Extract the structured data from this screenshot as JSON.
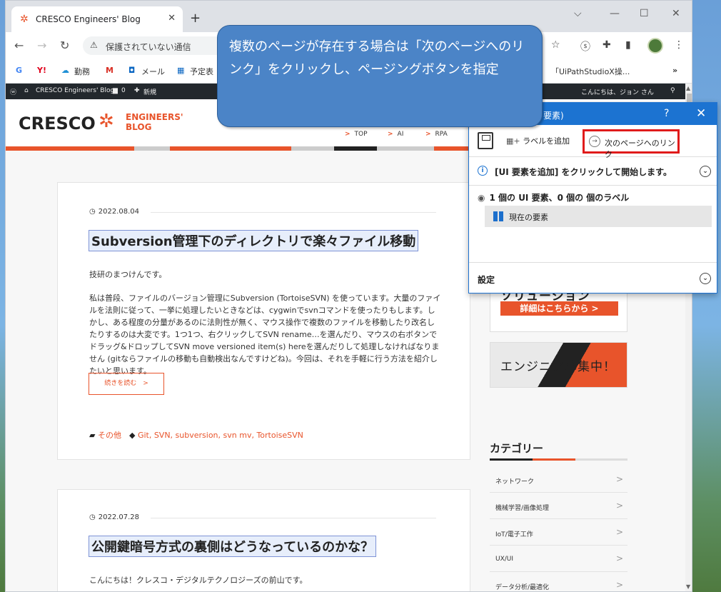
{
  "browser": {
    "tab_title": "CRESCO Engineers' Blog",
    "new_tab": "+",
    "address_security": "保護されていない通信",
    "window_controls": {
      "dropdown": "⌵",
      "minimize": "—",
      "maximize": "☐",
      "close": "✕"
    }
  },
  "bookmarks": [
    {
      "label": "G"
    },
    {
      "label": "Y!"
    },
    {
      "label": "勤務"
    },
    {
      "label": "M"
    },
    {
      "label": "メール"
    },
    {
      "label": "予定表"
    },
    {
      "label": "「UiPathStudioX操..."
    },
    {
      "label": "»"
    }
  ],
  "wp_admin": {
    "site": "CRESCO Engineers' Blog",
    "comments": "0",
    "new": "新規",
    "greeting": "こんにちは、ジョン さん"
  },
  "site": {
    "logo": "CRESCO",
    "logo_sub": "ENGINEERS' BLOG",
    "nav": [
      "TOP",
      "AI",
      "RPA"
    ]
  },
  "posts": [
    {
      "date": "2022.08.04",
      "title": "Subversion管理下のディレクトリで楽々ファイル移動",
      "intro": "技研のまつけんです。",
      "body": "私は普段、ファイルのバージョン管理にSubversion (TortoiseSVN) を使っています。大量のファイルを法則に従って、一挙に処理したいときなどは、cygwinでsvnコマンドを使ったりもします。しかし、ある程度の分量があるのに法則性が無く、マウス操作で複数のファイルを移動したり改名したりするのは大変です。1つ1つ、右クリックしてSVN rename…を選んだり、マウスの右ボタンでドラッグ&ドロップしてSVN move versioned item(s) hereを選んだりして処理しなければなりません (gitならファイルの移動も自動検出なんですけどね)。今回は、それを手軽に行う方法を紹介したいと思います。",
      "more": "続きを読む　>",
      "category": "その他",
      "tags": "Git, SVN, subversion, svn mv, TortoiseSVN"
    },
    {
      "date": "2022.07.28",
      "title": "公開鍵暗号方式の裏側はどうなっているのかな？",
      "intro": "こんにちは！クレスコ・デジタルテクノロジーズの前山です。"
    }
  ],
  "sidebar": {
    "banner1_text": "ソリューション",
    "banner1_button": "詳細はこちらから >",
    "banner2_text": "エンジニア募集中！",
    "category_heading": "カテゴリー",
    "categories": [
      "ネットワーク",
      "機械学習/画像処理",
      "IoT/電子工作",
      "UX/UI",
      "データ分析/最適化"
    ]
  },
  "callout": {
    "text": "複数のページが存在する場合は「次のページへのリンク」をクリックし、ページングボタンを指定"
  },
  "panel": {
    "title_fragment": "要素)",
    "help": "?",
    "close": "✕",
    "add_label": "ラベルを追加",
    "next_page_link": "次のページへのリンク",
    "info_text": "[UI 要素を追加] をクリックして開始します。",
    "summary": "1 個の UI 要素、0 個の 個のラベル",
    "current_element": "現在の要素",
    "settings": "設定"
  }
}
